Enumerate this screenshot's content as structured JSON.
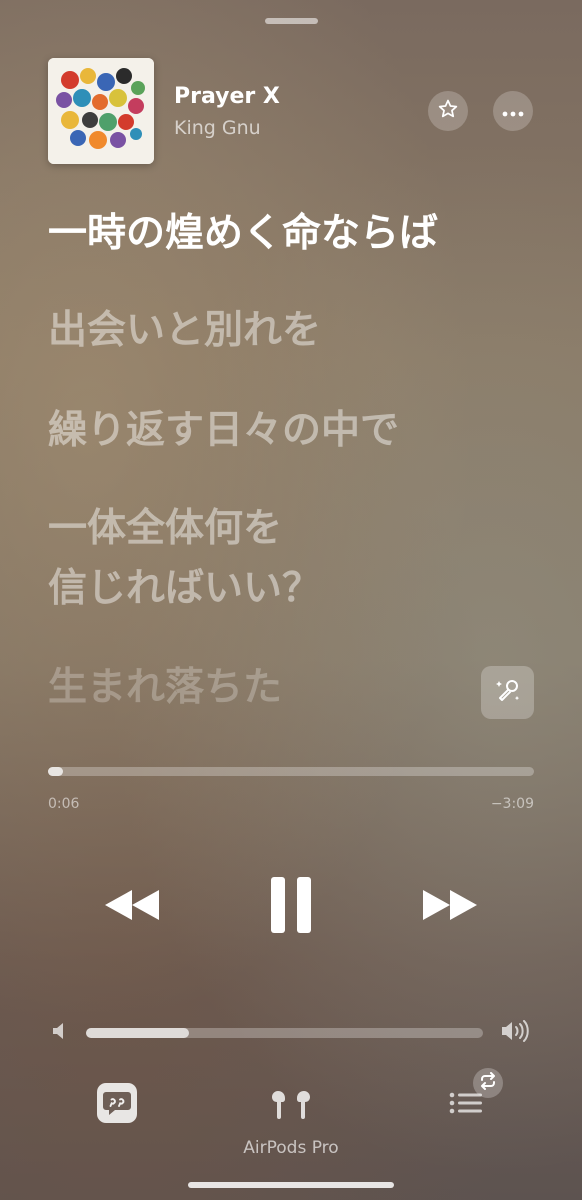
{
  "now_playing": {
    "title": "Prayer X",
    "artist": "King Gnu",
    "artwork_caption": "King Gnu"
  },
  "lyrics": [
    {
      "text": "一時の煌めく命ならば",
      "state": "active"
    },
    {
      "text": "出会いと別れを",
      "state": "upcoming"
    },
    {
      "text": "繰り返す日々の中で",
      "state": "upcoming"
    },
    {
      "text": "一体全体何を",
      "state": "upcoming"
    },
    {
      "text": "信じればいい？",
      "state": "upcoming"
    },
    {
      "text": "生まれ落ちた",
      "state": "faded"
    }
  ],
  "playback": {
    "elapsed": "0:06",
    "remaining": "−3:09",
    "progress_fraction": 0.03,
    "is_playing": true
  },
  "volume": {
    "level_fraction": 0.26
  },
  "output_device": {
    "label": "AirPods Pro"
  },
  "icons": {
    "favorite": "star-icon",
    "more": "ellipsis-icon",
    "sing": "microphone-sparkle-icon",
    "previous": "backward-icon",
    "pause": "pause-icon",
    "next": "forward-icon",
    "volume_low": "speaker-low-icon",
    "volume_high": "speaker-high-icon",
    "lyrics": "lyrics-bubble-icon",
    "airplay": "airpods-icon",
    "queue": "queue-list-icon",
    "repeat": "repeat-icon"
  }
}
